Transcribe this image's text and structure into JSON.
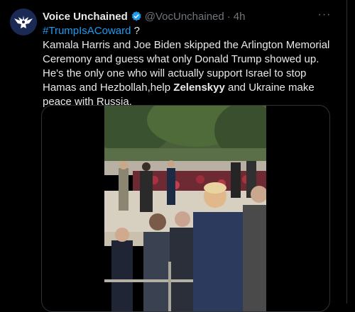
{
  "post": {
    "author_name": "Voice Unchained",
    "author_handle": "@VocUnchained",
    "separator": "·",
    "time": "4h",
    "more_icon": "more-icon",
    "verified_icon": "verified-badge-icon",
    "text": {
      "hashtag": "#TrumpIsACoward",
      "hashtag_suffix": " ?",
      "line1": "Kamala Harris and Joe Biden skipped the Arlington Memorial Ceremony and guess what only Donald Trump showed up.",
      "line2_a": "He's the only one who will actually support Israel to stop Hamas and Hezbollah,help ",
      "line2_bold": "Zelenskyy",
      "line2_b": " and Ukraine make peace with Russia."
    },
    "media": {
      "type": "video",
      "icon": "video-frame"
    }
  },
  "colors": {
    "background": "#000000",
    "text": "#e7e9ea",
    "secondary_text": "#71767b",
    "link": "#1d9bf0",
    "border": "#2f3336",
    "verified": "#1d9bf0"
  }
}
